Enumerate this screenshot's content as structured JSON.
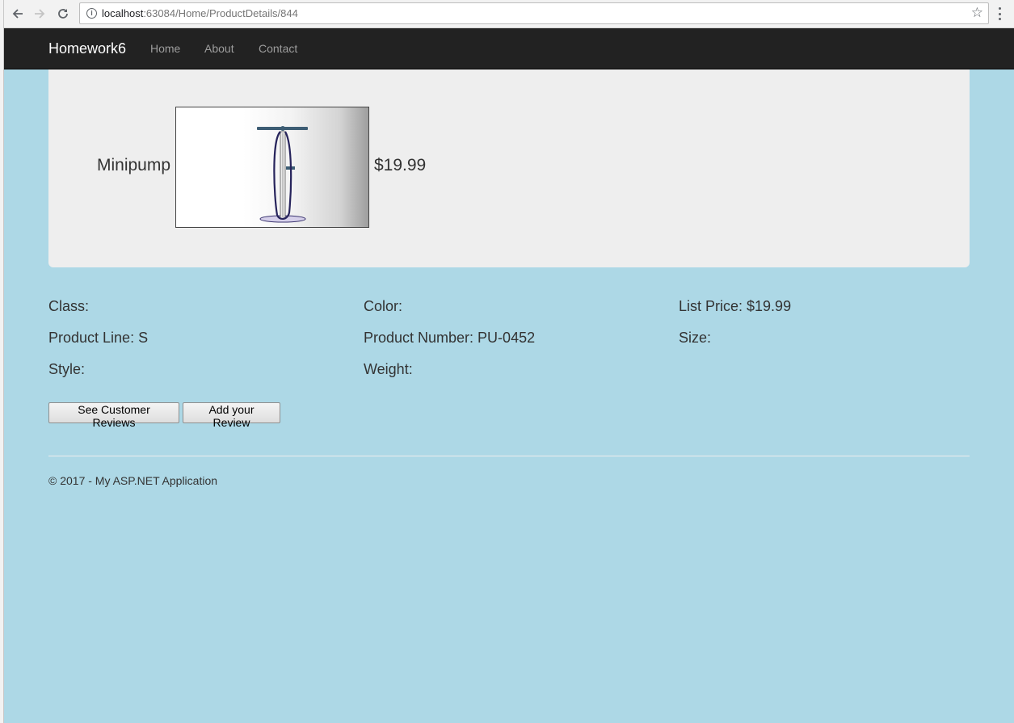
{
  "browser": {
    "url_host": "localhost",
    "url_path": ":63084/Home/ProductDetails/844"
  },
  "navbar": {
    "brand": "Homework6",
    "links": [
      "Home",
      "About",
      "Contact"
    ]
  },
  "product": {
    "name": "Minipump",
    "price": "$19.99"
  },
  "details": {
    "class": "Class:",
    "color": "Color:",
    "list_price": "List Price: $19.99",
    "product_line": "Product Line: S",
    "product_number": "Product Number: PU-0452",
    "size": "Size:",
    "style": "Style:",
    "weight": "Weight:"
  },
  "buttons": {
    "see_reviews": "See Customer Reviews",
    "add_review": "Add your Review"
  },
  "footer": {
    "text": "© 2017 - My ASP.NET Application"
  },
  "colors": {
    "page_background": "#add8e6",
    "navbar_background": "#222222",
    "jumbotron_background": "#eeeeee"
  }
}
